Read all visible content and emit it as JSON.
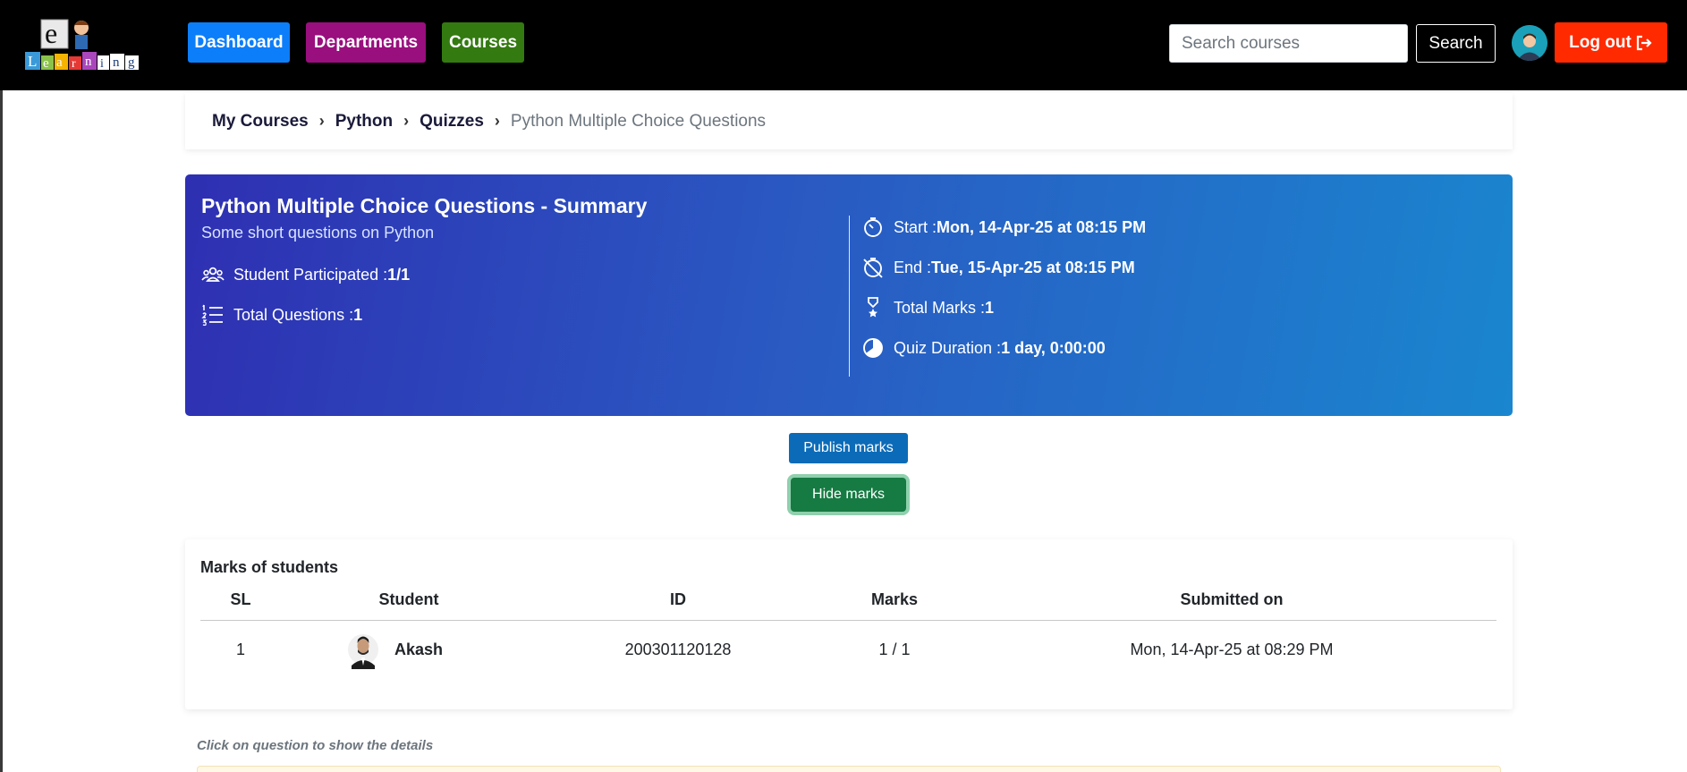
{
  "nav": {
    "logo_text": "eLearning",
    "dashboard": "Dashboard",
    "departments": "Departments",
    "courses": "Courses",
    "search_placeholder": "Search courses",
    "search_button": "Search",
    "logout": "Log out"
  },
  "breadcrumb": {
    "items": [
      "My Courses",
      "Python",
      "Quizzes"
    ],
    "active": "Python Multiple Choice Questions"
  },
  "summary": {
    "title": "Python Multiple Choice Questions - Summary",
    "subtitle": "Some short questions on Python",
    "participated_label": "Student Participated : ",
    "participated_value": "1/1",
    "questions_label": "Total Questions : ",
    "questions_value": "1",
    "start_label": "Start : ",
    "start_value": "Mon, 14-Apr-25 at 08:15 PM",
    "end_label": "End : ",
    "end_value": "Tue, 15-Apr-25 at 08:15 PM",
    "marks_label": "Total Marks : ",
    "marks_value": "1",
    "duration_label": "Quiz Duration : ",
    "duration_value": "1 day, 0:00:00"
  },
  "actions": {
    "publish": "Publish marks",
    "hide": "Hide marks"
  },
  "marks": {
    "title": "Marks of students",
    "columns": [
      "SL",
      "Student",
      "ID",
      "Marks",
      "Submitted on"
    ],
    "rows": [
      {
        "sl": "1",
        "student": "Akash",
        "id": "200301120128",
        "marks": "1 / 1",
        "submitted": "Mon, 14-Apr-25 at 08:29 PM"
      }
    ]
  },
  "hint": "Click on question to show the details",
  "colors": {
    "dashboard": "#0d7ef9",
    "departments": "#990f7e",
    "courses": "#337a10",
    "logout": "#ff2a00",
    "publish": "#0b6bb8",
    "hide": "#167a43"
  }
}
